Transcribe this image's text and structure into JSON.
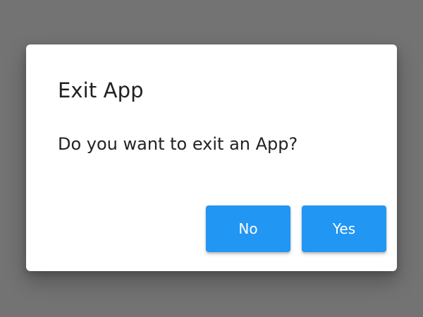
{
  "dialog": {
    "title": "Exit App",
    "message": "Do you want to exit an App?",
    "buttons": {
      "no_label": "No",
      "yes_label": "Yes"
    }
  },
  "colors": {
    "scrim": "#737373",
    "dialog_background": "#ffffff",
    "button_accent": "#2196f3",
    "title_text": "#212121",
    "message_text": "#222222",
    "button_text": "#ffffff"
  }
}
